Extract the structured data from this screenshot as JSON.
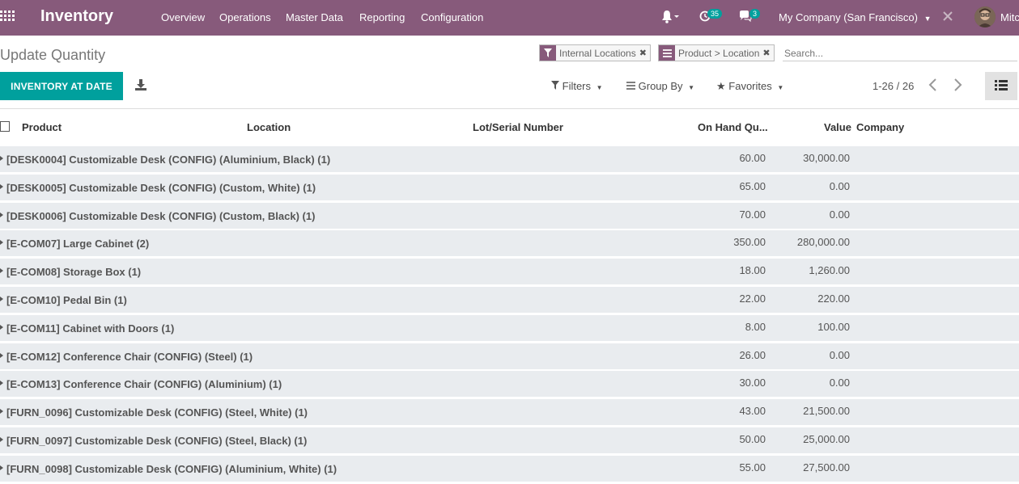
{
  "navbar": {
    "app_title": "Inventory",
    "menu": [
      "Overview",
      "Operations",
      "Master Data",
      "Reporting",
      "Configuration"
    ],
    "activity_count": "35",
    "message_count": "3",
    "company": "My Company (San Francisco)",
    "user": "Mitc"
  },
  "control": {
    "title": "Update Quantity",
    "facets": [
      {
        "label": "Internal Locations",
        "icon": "filter-icon"
      },
      {
        "label": "Product > Location",
        "icon": "group-by-icon"
      }
    ],
    "search_placeholder": "Search...",
    "inventory_button": "INVENTORY AT DATE",
    "filters_label": "Filters",
    "group_by_label": "Group By",
    "favorites_label": "Favorites",
    "pager": "1-26 / 26"
  },
  "table": {
    "columns": [
      "Product",
      "Location",
      "Lot/Serial Number",
      "On Hand Qu...",
      "Value",
      "Company"
    ],
    "rows": [
      {
        "name": "[DESK0004] Customizable Desk (CONFIG) (Aluminium, Black) (1)",
        "qty": "60.00",
        "value": "30,000.00"
      },
      {
        "name": "[DESK0005] Customizable Desk (CONFIG) (Custom, White) (1)",
        "qty": "65.00",
        "value": "0.00"
      },
      {
        "name": "[DESK0006] Customizable Desk (CONFIG) (Custom, Black) (1)",
        "qty": "70.00",
        "value": "0.00"
      },
      {
        "name": "[E-COM07] Large Cabinet (2)",
        "qty": "350.00",
        "value": "280,000.00"
      },
      {
        "name": "[E-COM08] Storage Box (1)",
        "qty": "18.00",
        "value": "1,260.00"
      },
      {
        "name": "[E-COM10] Pedal Bin (1)",
        "qty": "22.00",
        "value": "220.00"
      },
      {
        "name": "[E-COM11] Cabinet with Doors (1)",
        "qty": "8.00",
        "value": "100.00"
      },
      {
        "name": "[E-COM12] Conference Chair (CONFIG) (Steel) (1)",
        "qty": "26.00",
        "value": "0.00"
      },
      {
        "name": "[E-COM13] Conference Chair (CONFIG) (Aluminium) (1)",
        "qty": "30.00",
        "value": "0.00"
      },
      {
        "name": "[FURN_0096] Customizable Desk (CONFIG) (Steel, White) (1)",
        "qty": "43.00",
        "value": "21,500.00"
      },
      {
        "name": "[FURN_0097] Customizable Desk (CONFIG) (Steel, Black) (1)",
        "qty": "50.00",
        "value": "25,000.00"
      },
      {
        "name": "[FURN_0098] Customizable Desk (CONFIG) (Aluminium, White) (1)",
        "qty": "55.00",
        "value": "27,500.00"
      }
    ]
  },
  "colors": {
    "brand": "#875a7b",
    "primary": "#00a09d",
    "row_bg": "#e9ecef"
  }
}
